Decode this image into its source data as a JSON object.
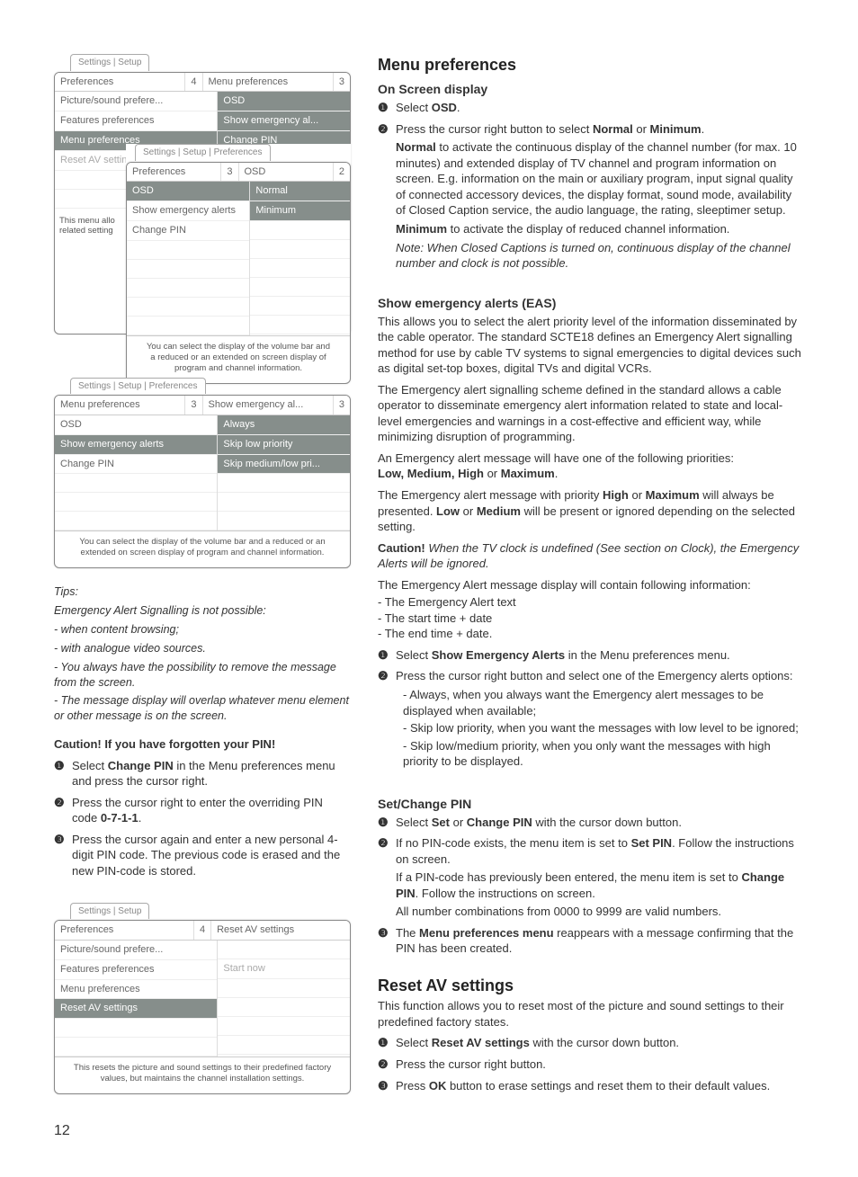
{
  "page_number": "12",
  "panelA": {
    "tab": "Settings | Setup",
    "hdr1_a": "Preferences",
    "hdr1_b": "4",
    "hdr1_c": "Menu preferences",
    "hdr1_d": "3",
    "left": [
      "Picture/sound prefere...",
      "Features preferences",
      "Menu preferences",
      "Reset AV settings"
    ],
    "right": [
      "OSD",
      "Show emergency al...",
      "Change PIN"
    ],
    "side_note": "This menu allo\nrelated setting"
  },
  "panelA_overlay": {
    "tab": "Settings | Setup | Preferences",
    "hdr_a": "Preferences",
    "hdr_b": "3",
    "hdr_c": "OSD",
    "hdr_d": "2",
    "left": [
      "OSD",
      "Show emergency alerts",
      "Change PIN"
    ],
    "right": [
      "Normal",
      "Minimum"
    ],
    "footer": "You can select the display of the volume bar and a reduced or an extended on screen display of program and channel information."
  },
  "panelB": {
    "tab": "Settings | Setup | Preferences",
    "hdr_a": "Menu preferences",
    "hdr_b": "3",
    "hdr_c": "Show emergency al...",
    "hdr_d": "3",
    "left": [
      "OSD",
      "Show emergency alerts",
      "Change PIN"
    ],
    "right": [
      "Always",
      "Skip low priority",
      "Skip medium/low pri..."
    ],
    "footer": "You can select the display of the volume bar and a reduced or an extended on screen display of program and channel information."
  },
  "panelC": {
    "tab": "Settings | Setup",
    "hdr_a": "Preferences",
    "hdr_b": "4",
    "hdr_c": "Reset AV settings",
    "left": [
      "Picture/sound prefere...",
      "Features preferences",
      "Menu preferences",
      "Reset AV settings"
    ],
    "right": [
      "",
      "Start now",
      "",
      ""
    ],
    "footer": "This resets the picture and sound settings to their predefined factory values, but maintains the channel installation settings."
  },
  "tips": {
    "title": "Tips:",
    "lead": "Emergency Alert Signalling is not possible:",
    "l1": "- when content browsing;",
    "l2": "- with analogue video sources.",
    "l3": "- You always have the possibility to remove the message from the screen.",
    "l4": "- The message display will overlap whatever menu element or other message is on the screen."
  },
  "caution_pin": {
    "title": "Caution! If you have forgotten your PIN!",
    "s1a": "Select ",
    "s1b": "Change PIN",
    "s1c": " in the Menu preferences menu and press the cursor right.",
    "s2a": "Press the cursor right to enter the overriding PIN code ",
    "s2b": "0-7-1-1",
    "s2c": ".",
    "s3": "Press the cursor again and enter a new personal 4-digit PIN code. The previous code is erased and the new PIN-code is stored."
  },
  "right": {
    "menu_title": "Menu preferences",
    "osd_title": "On Screen display",
    "osd_1a": "Select ",
    "osd_1b": "OSD",
    "osd_1c": ".",
    "osd_2a": "Press the cursor right button to select ",
    "osd_2b": "Normal",
    "osd_2c": " or ",
    "osd_2d": "Minimum",
    "osd_2e": ".",
    "osd_normal_b": "Normal",
    "osd_normal_txt": " to activate the continuous display of the channel number (for max. 10 minutes) and extended display of TV channel and program information on screen. E.g. information on the main or auxiliary program, input signal quality of connected accessory devices, the display format, sound mode, availability of Closed Caption service, the audio language, the rating, sleeptimer setup.",
    "osd_min_b": "Minimum",
    "osd_min_txt": " to activate the display of reduced channel information.",
    "osd_note": "Note: When Closed Captions is turned on, continuous display of the channel number and clock is not possible.",
    "eas_title": "Show emergency alerts (EAS)",
    "eas_p1": "This allows you to select the alert priority level of the information disseminated by the cable operator. The standard SCTE18 defines an Emergency Alert signalling method for use by cable TV systems to signal emergencies to digital devices such as digital set-top boxes, digital TVs and digital VCRs.",
    "eas_p2": "The Emergency alert signalling scheme defined in the standard allows a cable operator to disseminate emergency alert information related to state and local-level emergencies and warnings in a cost-effective and efficient way, while minimizing disruption of programming.",
    "eas_p3": "An Emergency alert message will have one of the following priorities:",
    "eas_levels_a": "Low, Medium, High",
    "eas_levels_b": " or ",
    "eas_levels_c": "Maximum",
    "eas_levels_d": ".",
    "eas_p4_a": "The Emergency alert message with priority ",
    "eas_p4_b": "High",
    "eas_p4_c": " or ",
    "eas_p4_d": "Maximum",
    "eas_p4_e": " will always be presented. ",
    "eas_p4_f": "Low",
    "eas_p4_g": " or ",
    "eas_p4_h": "Medium",
    "eas_p4_i": " will be present or ignored depending on the selected setting.",
    "eas_caution_b": "Caution!",
    "eas_caution_txt": " When the TV clock is undefined (See section on Clock), the Emergency Alerts will be ignored.",
    "eas_info_lead": "The Emergency Alert message display will contain following information:",
    "eas_info_1": "- The Emergency Alert text",
    "eas_info_2": "- The start time + date",
    "eas_info_3": "- The end time + date.",
    "eas_step1_a": "Select ",
    "eas_step1_b": "Show Emergency Alerts",
    "eas_step1_c": " in the Menu preferences menu.",
    "eas_step2": "Press the cursor right button and select one of the Emergency alerts options:",
    "eas_opt1": "- Always, when you always want the Emergency alert messages to be displayed when available;",
    "eas_opt2": "- Skip low priority, when you want the messages with low level to be ignored;",
    "eas_opt3": "- Skip low/medium priority, when you only want the messages with high priority to be displayed.",
    "pin_title": "Set/Change PIN",
    "pin_1a": "Select ",
    "pin_1b": "Set",
    "pin_1c": " or ",
    "pin_1d": "Change PIN",
    "pin_1e": " with the cursor down button.",
    "pin_2a": "If no PIN-code exists, the menu item is set to ",
    "pin_2b": "Set PIN",
    "pin_2c": ". Follow the instructions on screen.",
    "pin_2d": "If a PIN-code has previously been entered, the menu item is set to ",
    "pin_2e": "Change PIN",
    "pin_2f": ". Follow the instructions on screen.",
    "pin_2g": "All number combinations from 0000 to 9999 are valid numbers.",
    "pin_3a": "The ",
    "pin_3b": "Menu preferences menu",
    "pin_3c": " reappears with a message confirming that the PIN has been created.",
    "reset_title": "Reset AV settings",
    "reset_p": "This function allows you to reset most of the picture and sound settings to their predefined factory states.",
    "reset_1a": "Select ",
    "reset_1b": "Reset AV settings",
    "reset_1c": " with the cursor down button.",
    "reset_2": "Press the cursor right button.",
    "reset_3a": "Press ",
    "reset_3b": "OK",
    "reset_3c": " button to erase settings and reset them to their default values."
  }
}
